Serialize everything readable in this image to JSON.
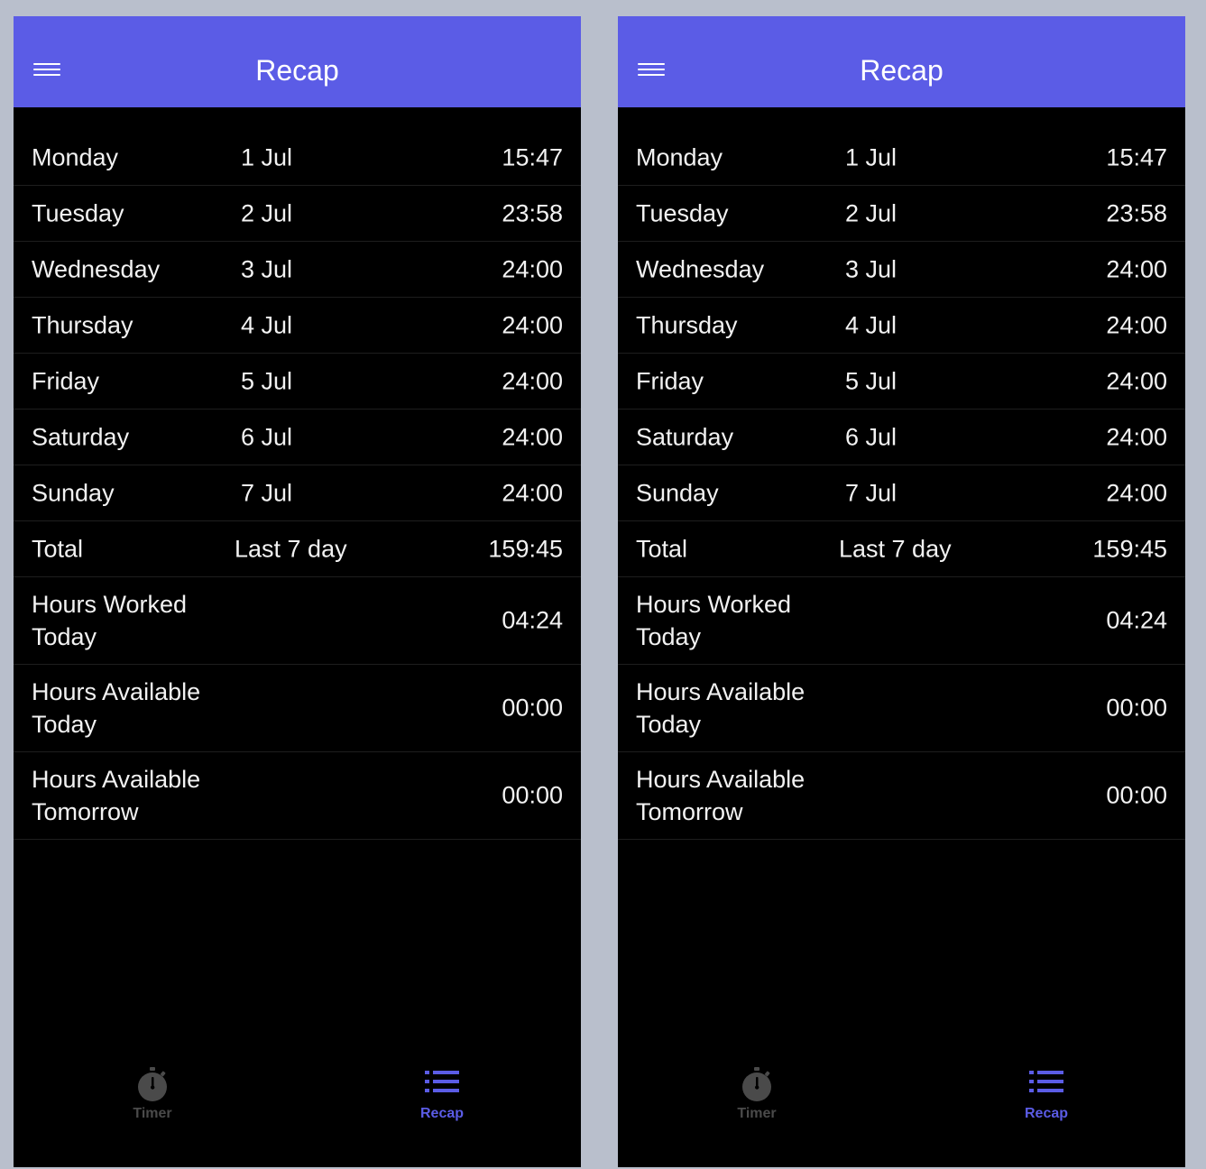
{
  "header": {
    "title": "Recap",
    "color": "#5b5ce6"
  },
  "rows": [
    {
      "day": "Monday",
      "date": "1 Jul",
      "value": "15:47"
    },
    {
      "day": "Tuesday",
      "date": "2 Jul",
      "value": "23:58"
    },
    {
      "day": "Wednesday",
      "date": "3 Jul",
      "value": "24:00"
    },
    {
      "day": "Thursday",
      "date": "4 Jul",
      "value": "24:00"
    },
    {
      "day": "Friday",
      "date": "5 Jul",
      "value": "24:00"
    },
    {
      "day": "Saturday",
      "date": "6 Jul",
      "value": "24:00"
    },
    {
      "day": "Sunday",
      "date": "7 Jul",
      "value": "24:00"
    }
  ],
  "total": {
    "label": "Total",
    "period": "Last 7 day",
    "value": "159:45"
  },
  "summary": [
    {
      "label": "Hours Worked Today",
      "value": "04:24"
    },
    {
      "label": "Hours Available Today",
      "value": "00:00"
    },
    {
      "label": "Hours Available Tomorrow",
      "value": "00:00"
    }
  ],
  "tabbar": {
    "timer_label": "Timer",
    "timer_icon": "stopwatch-icon",
    "recap_label": "Recap",
    "recap_icon": "list-icon",
    "active_tab": "Recap",
    "active_color": "#5b5ce6",
    "inactive_color": "#4a4a4a"
  }
}
